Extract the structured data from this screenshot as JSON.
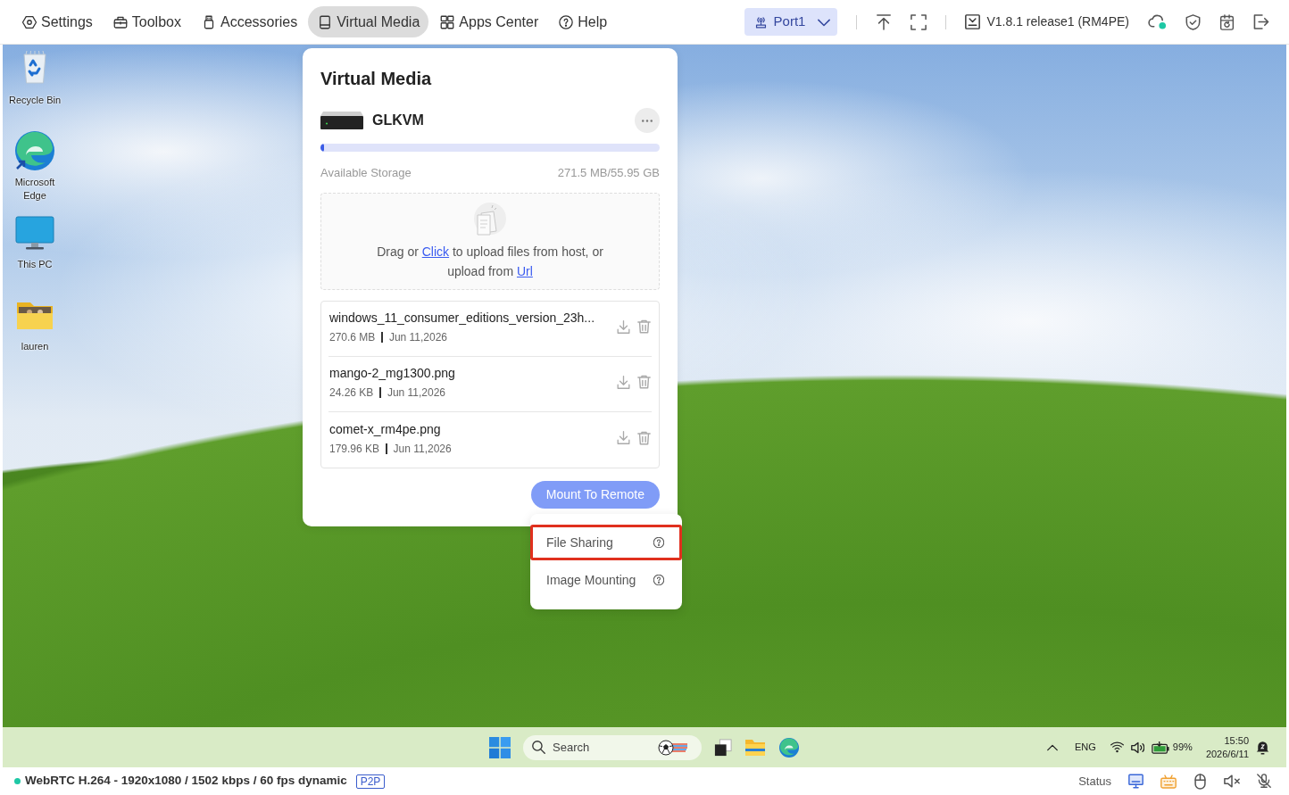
{
  "top_bar": {
    "tabs": [
      {
        "label": "Settings",
        "selected": false
      },
      {
        "label": "Toolbox",
        "selected": false
      },
      {
        "label": "Accessories",
        "selected": false
      },
      {
        "label": "Virtual Media",
        "selected": true
      },
      {
        "label": "Apps Center",
        "selected": false
      },
      {
        "label": "Help",
        "selected": false
      }
    ],
    "port": "Port1",
    "version": "V1.8.1 release1 (RM4PE)"
  },
  "remote_desktop": {
    "desktop_icons": [
      {
        "label": "Recycle Bin"
      },
      {
        "label": "Microsoft Edge"
      },
      {
        "label": "This PC"
      },
      {
        "label": "lauren"
      }
    ],
    "taskbar": {
      "search": {
        "placeholder": "Search"
      },
      "language": "ENG",
      "battery": "99%",
      "time": "15:50",
      "date": "2026/6/11"
    }
  },
  "virtual_media": {
    "title": "Virtual Media",
    "device": "GLKVM",
    "storage": {
      "label": "Available Storage",
      "reading": "271.5 MB/55.95 GB",
      "level": 0.01
    },
    "upload": {
      "segments": [
        {
          "kind": "text",
          "text": "Drag or"
        },
        {
          "kind": "link",
          "text": "Click"
        },
        {
          "kind": "text",
          "text": "to upload files from host, or upload from"
        },
        {
          "kind": "link",
          "text": "Url"
        }
      ]
    },
    "files": [
      {
        "name": "windows_11_consumer_editions_version_23h...",
        "size": "270.6 MB",
        "date": "Jun 11,2026"
      },
      {
        "name": "mango-2_mg1300.png",
        "size": "24.26 KB",
        "date": "Jun 11,2026"
      },
      {
        "name": "comet-x_rm4pe.png",
        "size": "179.96 KB",
        "date": "Jun 11,2026"
      }
    ],
    "mount_button": "Mount To Remote",
    "menu": [
      {
        "label": "File Sharing",
        "highlighted": true
      },
      {
        "label": "Image Mounting",
        "highlighted": false
      }
    ]
  },
  "status_bar": {
    "stream": "WebRTC H.264 - 1920x1080 / 1502 kbps / 60 fps dynamic",
    "mode": "P2P",
    "status_label": "Status"
  }
}
